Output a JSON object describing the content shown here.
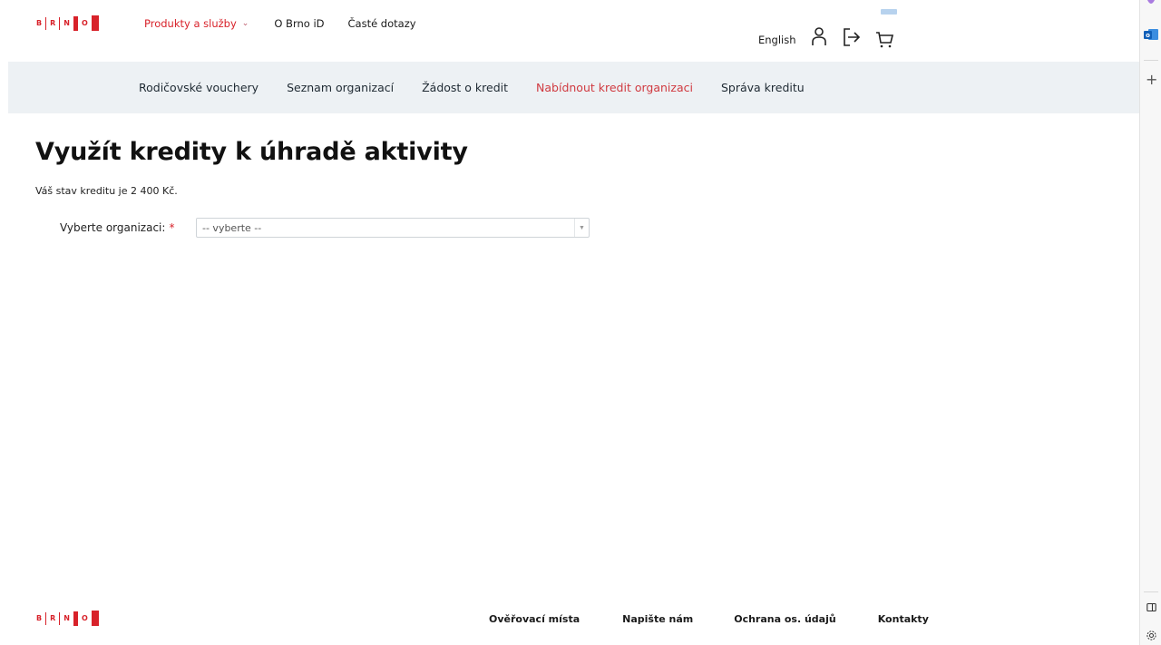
{
  "logo": {
    "letters": [
      "B",
      "R",
      "N",
      "O"
    ]
  },
  "header": {
    "nav": {
      "products_label": "Produkty a služby",
      "brno_id_label": "O Brno iD",
      "faq_label": "Časté dotazy"
    },
    "language_label": "English",
    "icons": [
      "user-icon",
      "logout-icon",
      "cart-icon"
    ]
  },
  "subnav": {
    "items": [
      {
        "label": "Rodičovské vouchery"
      },
      {
        "label": "Seznam organizací"
      },
      {
        "label": "Žádost o kredit"
      },
      {
        "label": "Nabídnout kredit organizaci",
        "active": true
      },
      {
        "label": "Správa kreditu"
      }
    ]
  },
  "main": {
    "title": "Využít kredity k úhradě aktivity",
    "credit_text": "Váš stav kreditu je 2 400 Kč.",
    "form": {
      "org_label": "Vyberte organizaci:",
      "required_mark": "*",
      "org_select_value": "-- vyberte --"
    }
  },
  "footer": {
    "links": [
      {
        "label": "Ověřovací místa"
      },
      {
        "label": "Napište nám"
      },
      {
        "label": "Ochrana os. údajů"
      },
      {
        "label": "Kontakty"
      }
    ]
  },
  "browser_sidebar": {
    "add_label": "+"
  },
  "colors": {
    "brand_red": "#d8222a",
    "active_nav": "#d03a40",
    "subnav_bg": "#edf1f4"
  }
}
